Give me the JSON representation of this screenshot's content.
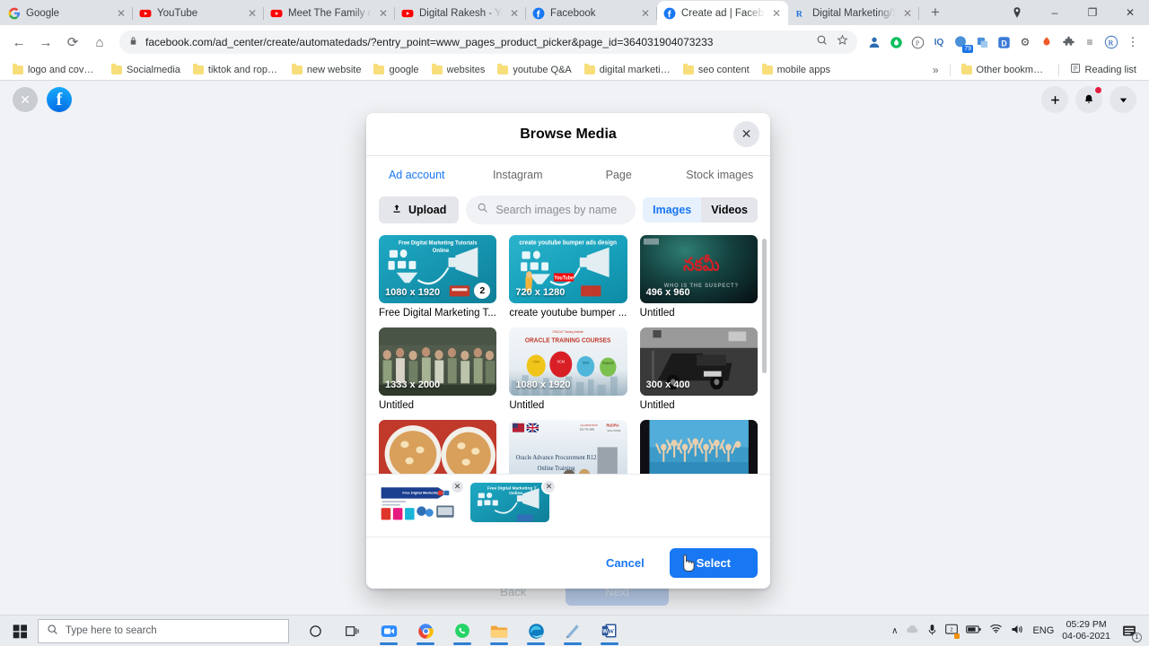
{
  "browser": {
    "tabs": [
      {
        "title": "Google",
        "favicon": "google-icon",
        "active": false
      },
      {
        "title": "YouTube",
        "favicon": "youtube-icon",
        "active": false
      },
      {
        "title": "Meet The Family of M",
        "favicon": "youtube-icon",
        "active": false
      },
      {
        "title": "Digital Rakesh - YouT",
        "favicon": "youtube-icon",
        "active": false
      },
      {
        "title": "Facebook",
        "favicon": "facebook-icon",
        "active": false
      },
      {
        "title": "Create ad | Facebook",
        "favicon": "facebook-icon",
        "active": true
      },
      {
        "title": "Digital Marketing/SEO",
        "favicon": "rank-math-icon",
        "active": false
      }
    ],
    "new_tab_label": "+",
    "window_controls": {
      "minimize": "–",
      "maximize": "❐",
      "close": "✕"
    },
    "profile_icon": "profile-avatar-icon",
    "nav": {
      "back": "←",
      "forward": "→",
      "reload": "⟳",
      "home": "⌂"
    },
    "omnibox": {
      "lock_icon": "lock-icon",
      "url": "facebook.com/ad_center/create/automatedads/?entry_point=www_pages_product_picker&page_id=364031904073233",
      "zoom_icon": "search-icon",
      "bookmark_icon": "star-icon"
    },
    "extensions": [
      {
        "name": "grammarly-extension-icon",
        "glyph": "P"
      },
      {
        "name": "green-shield-extension-icon",
        "glyph": "●"
      },
      {
        "name": "pinterest-extension-icon",
        "glyph": "Ⓟ"
      },
      {
        "name": "iq-extension-icon",
        "glyph": "IQ"
      },
      {
        "name": "buffer-extension-icon",
        "glyph": "◕",
        "badge": "79"
      },
      {
        "name": "translate-extension-icon",
        "glyph": "❐"
      },
      {
        "name": "d-extension-icon",
        "glyph": "D"
      },
      {
        "name": "bug-extension-icon",
        "glyph": "⚙"
      },
      {
        "name": "fire-extension-icon",
        "glyph": "●"
      },
      {
        "name": "puzzle-extensions-icon",
        "glyph": "❖"
      },
      {
        "name": "playlist-extension-icon",
        "glyph": "≡"
      },
      {
        "name": "rank-math-extension-icon",
        "glyph": "R"
      },
      {
        "name": "chrome-menu-icon",
        "glyph": "⋮"
      }
    ],
    "bookmarks": [
      "logo and cover ima...",
      "Socialmedia",
      "tiktok and roposo",
      "new website",
      "google",
      "websites",
      "youtube Q&A",
      "digital marketing li...",
      "seo content",
      "mobile apps"
    ],
    "bookmarks_overflow": "»",
    "other_bookmarks": "Other bookmarks",
    "reading_list": "Reading list"
  },
  "fb_page": {
    "close_label": "✕",
    "logo_letter": "f",
    "actions": [
      {
        "name": "add-button",
        "glyph": "+"
      },
      {
        "name": "notifications-bell-button",
        "glyph": "🔔",
        "has_dot": true
      },
      {
        "name": "account-menu-button",
        "glyph": "▾"
      }
    ],
    "back_label": "Back",
    "next_label": "Next"
  },
  "modal": {
    "title": "Browse Media",
    "close_label": "✕",
    "tabs": [
      {
        "label": "Ad account",
        "active": true
      },
      {
        "label": "Instagram",
        "active": false
      },
      {
        "label": "Page",
        "active": false
      },
      {
        "label": "Stock images",
        "active": false
      }
    ],
    "toolbar": {
      "upload_label": "Upload",
      "upload_icon": "upload-icon",
      "search_icon": "search-icon",
      "search_value": "",
      "search_placeholder": "Search images by name",
      "images_label": "Images",
      "videos_label": "Videos"
    },
    "media": [
      {
        "caption": "Free Digital Marketing T...",
        "dimensions": "1080 x 1920",
        "count": "2",
        "overlay_text": "Free Digital Marketing Tutorials Online",
        "kind": "marketing-funnel-teal"
      },
      {
        "caption": "create youtube bumper ...",
        "dimensions": "720 x 1280",
        "count": "",
        "overlay_text": "create youtube bumper ads design",
        "kind": "marketing-funnel-teal"
      },
      {
        "caption": "Untitled",
        "dimensions": "496 x 960",
        "count": "",
        "overlay_text": "WHO IS THE SUSPECT?",
        "kind": "dark-movie-poster"
      },
      {
        "caption": "Untitled",
        "dimensions": "1333 x 2000",
        "count": "",
        "overlay_text": "",
        "kind": "group-photo"
      },
      {
        "caption": "Untitled",
        "dimensions": "1080 x 1920",
        "count": "",
        "overlay_text": "ORACLE TRAINING COURSES",
        "kind": "oracle-courses"
      },
      {
        "caption": "Untitled",
        "dimensions": "300 x 400",
        "count": "",
        "overlay_text": "",
        "kind": "bw-truck"
      },
      {
        "caption": "",
        "dimensions": "",
        "count": "",
        "overlay_text": "",
        "kind": "food-bowls"
      },
      {
        "caption": "",
        "dimensions": "",
        "count": "",
        "overlay_text": "Oracle Advance Procurement R12 Online Training",
        "kind": "oracle-training-banner"
      },
      {
        "caption": "",
        "dimensions": "",
        "count": "",
        "overlay_text": "",
        "kind": "pool-crowd"
      }
    ],
    "selected": [
      {
        "name": "selected-thumb-1",
        "remove_label": "✕",
        "kind": "blue-banner"
      },
      {
        "name": "selected-thumb-2",
        "remove_label": "✕",
        "kind": "marketing-funnel-teal",
        "overlay_text": "Free Digital Marketing T..."
      }
    ],
    "footer": {
      "cancel_label": "Cancel",
      "select_label": "Select"
    }
  },
  "taskbar": {
    "start_icon": "windows-start-icon",
    "search_icon": "search-icon",
    "search_placeholder": "Type here to search",
    "items": [
      {
        "name": "cortana-icon",
        "glyph": "◯",
        "running": false
      },
      {
        "name": "task-view-icon",
        "glyph": "⧉",
        "running": false
      },
      {
        "name": "zoom-taskbar-icon",
        "glyph": "▣",
        "running": true
      },
      {
        "name": "chrome-taskbar-icon",
        "glyph": "◉",
        "running": true
      },
      {
        "name": "whatsapp-taskbar-icon",
        "glyph": "✆",
        "running": true
      },
      {
        "name": "file-explorer-taskbar-icon",
        "glyph": "▬",
        "running": true
      },
      {
        "name": "edge-taskbar-icon",
        "glyph": "◔",
        "running": true
      },
      {
        "name": "snipping-tool-taskbar-icon",
        "glyph": "◢",
        "running": true
      },
      {
        "name": "word-taskbar-icon",
        "glyph": "W",
        "running": true
      }
    ],
    "tray": {
      "chevron": "∧",
      "onedrive_icon": "cloud-icon",
      "mic_icon": "microphone-icon",
      "display_icon": "display-icon",
      "battery_icon": "battery-icon",
      "wifi_icon": "wifi-icon",
      "volume_icon": "volume-icon",
      "language": "ENG",
      "time": "05:29 PM",
      "date": "04-06-2021",
      "action_center_badge": "1"
    },
    "colors": {
      "accent": "#1877f2",
      "taskbar_bg": "#e9ecef"
    }
  }
}
